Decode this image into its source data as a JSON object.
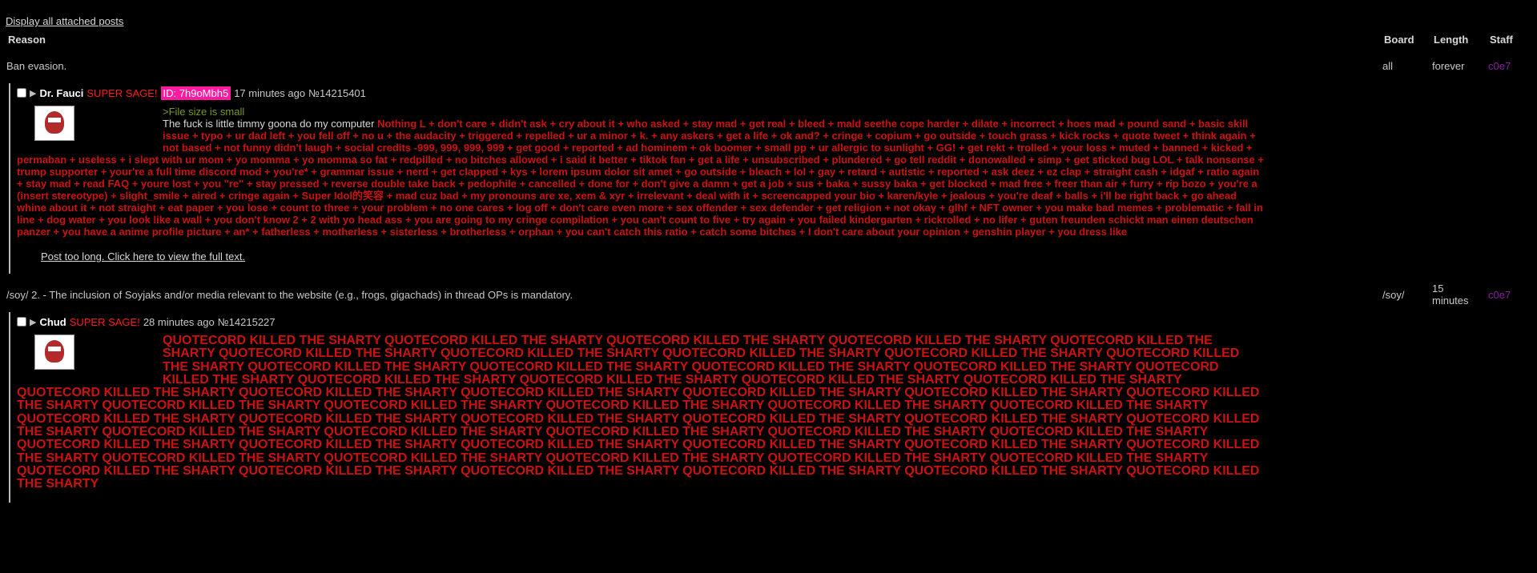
{
  "display_all_link": "Display all attached posts",
  "headers": {
    "reason": "Reason",
    "board": "Board",
    "length": "Length",
    "staff": "Staff"
  },
  "bans": [
    {
      "reason": "Ban evasion.",
      "board": "all",
      "length": "forever",
      "staff": "c0e7",
      "post": {
        "name": "Dr. Fauci",
        "sage": "SUPER SAGE!",
        "id_badge": "ID: 7h9oMbh5",
        "time": "17 minutes ago",
        "number": "№14215401",
        "greentext": ">File size is small",
        "lead": "The fuck is little timmy goona do my computer",
        "body": "Nothing L + don't care + didn't ask + cry about it + who asked + stay mad + get real + bleed + mald seethe cope harder + dilate + incorrect + hoes mad + pound sand + basic skill issue + typo + ur dad left + you fell off + no u + the audacity + triggered + repelled + ur a minor + k. + any askers + get a life + ok and? + cringe + copium + go outside + touch grass + kick rocks + quote tweet + think again + not based + not funny didn't laugh + social credits -999, 999, 999, 999 + get good + reported + ad hominem + ok boomer + small pp + ur allergic to sunlight + GG! + get rekt + trolled + your loss + muted + banned + kicked + permaban + useless + i slept with ur mom + yo momma + yo momma so fat + redpilled + no bitches allowed + i said it better + tiktok fan + get a life + unsubscribed + plundered + go tell reddit + donowalled + simp + get sticked bug LOL + talk nonsense + trump supporter + your're a full time discord mod + you're* + grammar issue + nerd + get clapped + kys + lorem ipsum dolor sit amet + go outside + bleach + lol + gay + retard + autistic + reported + ask deez + ez clap + straight cash + idgaf + ratio again + stay mad + read FAQ + youre lost + you \"re\" + stay pressed + reverse double take back + pedophile + cancelled + done for + don't give a damn + get a job + sus + baka + sussy baka + get blocked + mad free + freer than air + furry + rip bozo + you're a (insert stereotype) + slight_smile + aired + cringe again + Super Idol的笑容 + mad cuz bad + my pronouns are xe, xem & xyr + irrelevant + deal with it + screencapped your bio + karen/kyle + jealous + you're deaf + balls + i'll be right back + go ahead whine about it + not straight + eat paper + you lose + count to three + your problem + no one cares + log off + don't care even more + sex offender + sex defender + get religion + not okay + glhf + NFT owner + you make bad memes + problematic + fall in line + dog water + you look like a wall + you don't know 2 + 2 with yo head ass + you are going to my cringe compilation + you can't count to five + try again + you failed kindergarten + rickrolled + no lifer + guten freunden schickt man einen deutschen panzer + you have a anime profile picture + an* + fatherless + motherless + sisterless + brotherless + orphan + you can't catch this ratio + catch some bitches + I don't care about your opinion + genshin player + you dress like",
        "too_long": "Post too long. Click here to view the full text."
      }
    },
    {
      "reason": "/soy/ 2. - The inclusion of Soyjaks and/or media relevant to the website (e.g., frogs, gigachads) in thread OPs is mandatory.",
      "board": "/soy/",
      "length": "15 minutes",
      "staff": "c0e7",
      "post": {
        "name": "Chud",
        "sage": "SUPER SAGE!",
        "time": "28 minutes ago",
        "number": "№14215227",
        "body": "QUOTECORD KILLED THE SHARTY QUOTECORD KILLED THE SHARTY QUOTECORD KILLED THE SHARTY QUOTECORD KILLED THE SHARTY QUOTECORD KILLED THE SHARTY QUOTECORD KILLED THE SHARTY QUOTECORD KILLED THE SHARTY QUOTECORD KILLED THE SHARTY QUOTECORD KILLED THE SHARTY QUOTECORD KILLED THE SHARTY QUOTECORD KILLED THE SHARTY QUOTECORD KILLED THE SHARTY QUOTECORD KILLED THE SHARTY QUOTECORD KILLED THE SHARTY QUOTECORD KILLED THE SHARTY QUOTECORD KILLED THE SHARTY QUOTECORD KILLED THE SHARTY QUOTECORD KILLED THE SHARTY QUOTECORD KILLED THE SHARTY QUOTECORD KILLED THE SHARTY QUOTECORD KILLED THE SHARTY QUOTECORD KILLED THE SHARTY QUOTECORD KILLED THE SHARTY QUOTECORD KILLED THE SHARTY QUOTECORD KILLED THE SHARTY QUOTECORD KILLED THE SHARTY QUOTECORD KILLED THE SHARTY QUOTECORD KILLED THE SHARTY QUOTECORD KILLED THE SHARTY QUOTECORD KILLED THE SHARTY QUOTECORD KILLED THE SHARTY QUOTECORD KILLED THE SHARTY QUOTECORD KILLED THE SHARTY QUOTECORD KILLED THE SHARTY QUOTECORD KILLED THE SHARTY QUOTECORD KILLED THE SHARTY QUOTECORD KILLED THE SHARTY QUOTECORD KILLED THE SHARTY QUOTECORD KILLED THE SHARTY QUOTECORD KILLED THE SHARTY QUOTECORD KILLED THE SHARTY QUOTECORD KILLED THE SHARTY QUOTECORD KILLED THE SHARTY QUOTECORD KILLED THE SHARTY QUOTECORD KILLED THE SHARTY QUOTECORD KILLED THE SHARTY QUOTECORD KILLED THE SHARTY QUOTECORD KILLED THE SHARTY QUOTECORD KILLED THE SHARTY QUOTECORD KILLED THE SHARTY QUOTECORD KILLED THE SHARTY QUOTECORD KILLED THE SHARTY QUOTECORD KILLED THE SHARTY QUOTECORD KILLED THE SHARTY QUOTECORD KILLED THE SHARTY QUOTECORD KILLED THE SHARTY QUOTECORD KILLED THE SHARTY QUOTECORD KILLED THE SHARTY"
      }
    }
  ]
}
